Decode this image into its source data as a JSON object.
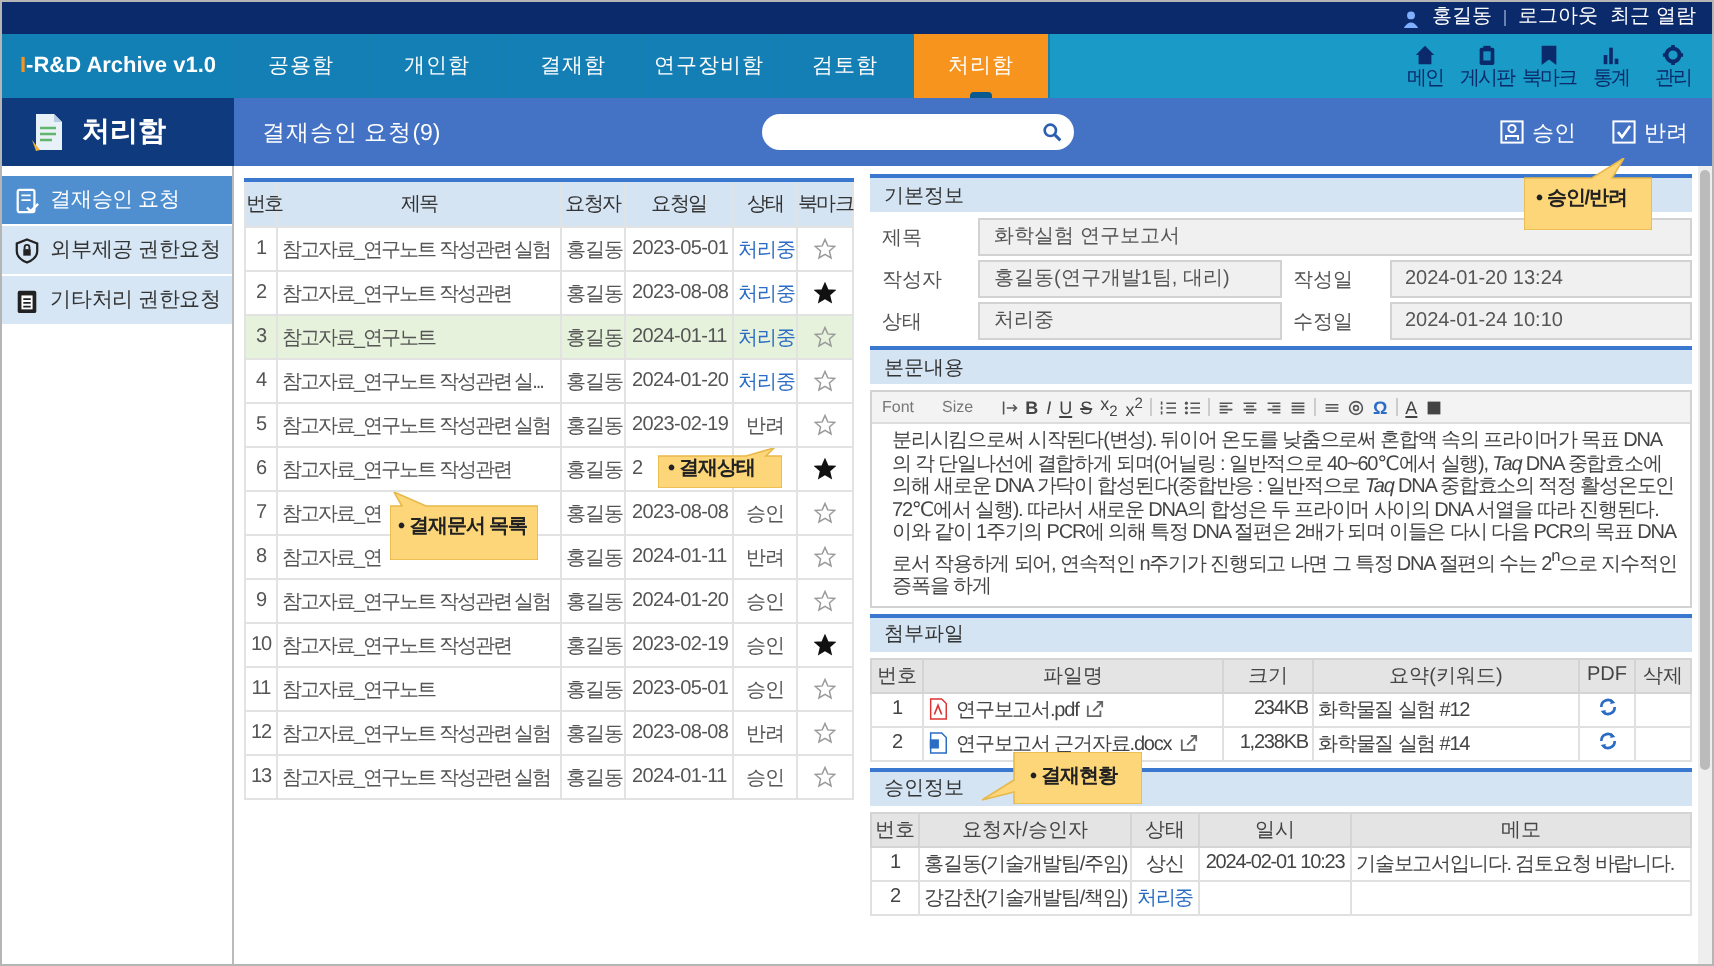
{
  "topbar": {
    "user": "홍길동",
    "logout": "로그아웃",
    "recent": "최근 열람"
  },
  "logo": {
    "accent": "I",
    "text": "-R&D Archive v1.0"
  },
  "nav": {
    "tabs": [
      {
        "label": "공용함",
        "selected": false
      },
      {
        "label": "개인함",
        "selected": false
      },
      {
        "label": "결재함",
        "selected": false
      },
      {
        "label": "연구장비함",
        "selected": false
      },
      {
        "label": "검토함",
        "selected": false
      },
      {
        "label": "처리함",
        "selected": true
      }
    ],
    "shortcuts": [
      "메인",
      "게시판",
      "북마크",
      "통계",
      "관리"
    ]
  },
  "sidebar": {
    "title": "처리함",
    "items": [
      {
        "label": "결재승인 요청",
        "selected": true
      },
      {
        "label": "외부제공 권한요청",
        "selected": false
      },
      {
        "label": "기타처리 권한요청",
        "selected": false
      }
    ]
  },
  "header": {
    "title": "결재승인 요청(9)",
    "approve": "승인",
    "reject": "반려"
  },
  "table": {
    "columns": [
      "번호",
      "제목",
      "요청자",
      "요청일",
      "상태",
      "북마크"
    ],
    "rows": [
      {
        "no": "1",
        "title": "참고자료_연구노트 작성관련 실험",
        "requester": "홍길동",
        "date": "2023-05-01",
        "status": "처리중",
        "kind": "pending",
        "bookmarked": false,
        "selected": false
      },
      {
        "no": "2",
        "title": "참고자료_연구노트 작성관련",
        "requester": "홍길동",
        "date": "2023-08-08",
        "status": "처리중",
        "kind": "pending",
        "bookmarked": true,
        "selected": false
      },
      {
        "no": "3",
        "title": "참고자료_연구노트",
        "requester": "홍길동",
        "date": "2024-01-11",
        "status": "처리중",
        "kind": "pending",
        "bookmarked": false,
        "selected": true
      },
      {
        "no": "4",
        "title": "참고자료_연구노트 작성관련 실...",
        "requester": "홍길동",
        "date": "2024-01-20",
        "status": "처리중",
        "kind": "pending",
        "bookmarked": false,
        "selected": false
      },
      {
        "no": "5",
        "title": "참고자료_연구노트 작성관련 실험",
        "requester": "홍길동",
        "date": "2023-02-19",
        "status": "반려",
        "kind": "done",
        "bookmarked": false,
        "selected": false
      },
      {
        "no": "6",
        "title": "참고자료_연구노트 작성관련",
        "requester": "홍길동",
        "date": "2",
        "bookmarked": true,
        "selected": false
      },
      {
        "no": "7",
        "title": "참고자료_연",
        "requester": "홍길동",
        "date": "2023-08-08",
        "status": "승인",
        "kind": "done",
        "bookmarked": false,
        "selected": false
      },
      {
        "no": "8",
        "title": "참고자료_연",
        "requester": "홍길동",
        "date": "2024-01-11",
        "status": "반려",
        "kind": "done",
        "bookmarked": false,
        "selected": false
      },
      {
        "no": "9",
        "title": "참고자료_연구노트 작성관련 실험",
        "requester": "홍길동",
        "date": "2024-01-20",
        "status": "승인",
        "kind": "done",
        "bookmarked": false,
        "selected": false
      },
      {
        "no": "10",
        "title": "참고자료_연구노트 작성관련",
        "requester": "홍길동",
        "date": "2023-02-19",
        "status": "승인",
        "kind": "done",
        "bookmarked": true,
        "selected": false
      },
      {
        "no": "11",
        "title": "참고자료_연구노트",
        "requester": "홍길동",
        "date": "2023-05-01",
        "status": "승인",
        "kind": "done",
        "bookmarked": false,
        "selected": false
      },
      {
        "no": "12",
        "title": "참고자료_연구노트 작성관련 실험",
        "requester": "홍길동",
        "date": "2023-08-08",
        "status": "반려",
        "kind": "done",
        "bookmarked": false,
        "selected": false
      },
      {
        "no": "13",
        "title": "참고자료_연구노트 작성관련 실험",
        "requester": "홍길동",
        "date": "2024-01-11",
        "status": "승인",
        "kind": "done",
        "bookmarked": false,
        "selected": false
      }
    ]
  },
  "basic_info": {
    "title": "기본정보",
    "fields": [
      {
        "label": "제목",
        "value": "화학실험 연구보고서"
      },
      {
        "label": "작성자",
        "value": "홍길동(연구개발1팀, 대리)"
      },
      {
        "label": "작성일",
        "value": "2024-01-20  13:24"
      },
      {
        "label": "상태",
        "value": "처리중"
      },
      {
        "label": "수정일",
        "value": "2024-01-24  10:10"
      }
    ]
  },
  "content": {
    "title": "본문내용",
    "font_label": "Font",
    "size_label": "Size",
    "tools": [
      "B",
      "I",
      "U",
      "S",
      "x$_{2}$",
      "x$^{2}$",
      "Ω",
      "A"
    ],
    "body": "분리시킴으로써 시작된다(변성). 뒤이어 온도를 낮춤으로써 혼합액 속의 프라이머가 목표 DNA의 각 단일나선에 결합하게 되며(어닐링 : 일반적으로 40~60℃에서 실행), *Taq* DNA 중합효소에 의해 새로운 DNA 가닥이 합성된다(중합반응 : 일반적으로 *Taq* DNA 중합효소의 적정 활성온도인 72℃에서 실행). 따라서 새로운 DNA의 합성은 두 프라이머 사이의 DNA 서열을 따라 진행된다. 이와 같이 1주기의 PCR에 의해 특정 DNA 절편은 2배가 되며 이들은 다시 다음 PCR의 목표 DNA로서  작용하게 되어, 연속적인 n주기가 진행되고 나면 그 특정 DNA 절편의 수는 2$^{n}$으로 지수적인 증폭을 하게"
  },
  "attachments": {
    "title": "첨부파일",
    "columns": [
      "번호",
      "파일명",
      "크기",
      "요약(키워드)",
      "PDF",
      "삭제"
    ],
    "rows": [
      {
        "no": "1",
        "name": "연구보고서.pdf",
        "kind": "pdf",
        "size": "234KB",
        "summary": "화학물질 실험 #12"
      },
      {
        "no": "2",
        "name": "연구보고서 근거자료.docx",
        "kind": "doc",
        "size": "1,238KB",
        "summary": "화학물질 실험 #14"
      }
    ]
  },
  "approval": {
    "title": "승인정보",
    "columns": [
      "번호",
      "요청자/승인자",
      "상태",
      "일시",
      "메모"
    ],
    "rows": [
      {
        "no": "1",
        "person": "홍길동(기술개발팀/주임)",
        "status": "상신",
        "kind": "done",
        "time": "2024-02-01  10:23",
        "memo": "기술보고서입니다. 검토요청 바랍니다."
      },
      {
        "no": "2",
        "person": "강감찬(기술개발팀/책임)",
        "status": "처리중",
        "kind": "pending"
      }
    ]
  },
  "callouts": [
    {
      "kind": "actions",
      "text": "• 승인/반려"
    },
    {
      "kind": "status",
      "text": "• 결재상태"
    },
    {
      "kind": "list",
      "text": "• 결재문서 목록"
    },
    {
      "kind": "approval",
      "text": "• 결재현황"
    }
  ]
}
